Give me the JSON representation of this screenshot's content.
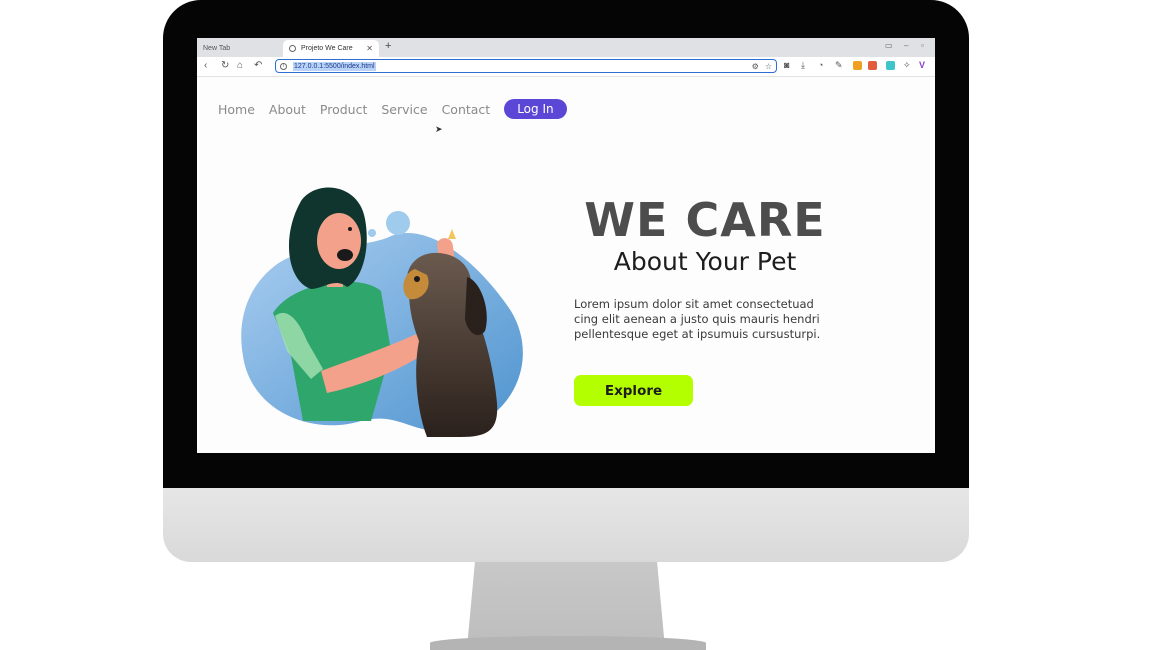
{
  "browser": {
    "tabs": [
      {
        "label": "New Tab",
        "active": false
      },
      {
        "label": "Projeto We Care",
        "active": true
      }
    ],
    "new_tab_symbol": "+",
    "url": "127.0.0.1:5500/index.html",
    "nav_icons": [
      "back-icon",
      "reload-icon",
      "home-icon",
      "undo-icon"
    ],
    "extension_colors": [
      "#e25b3a",
      "#f0a020",
      "#3fc4c9",
      "#8a3fd0"
    ]
  },
  "page": {
    "nav": {
      "items": [
        "Home",
        "About",
        "Product",
        "Service",
        "Contact"
      ],
      "login_label": "Log In"
    },
    "hero": {
      "title": "WE CARE",
      "subtitle": "About Your Pet",
      "text_lines": [
        "Lorem ipsum dolor sit amet consectetuad",
        "cing elit aenean a justo quis mauris hendri",
        "pellentesque eget at ipsumuis cursusturpi."
      ],
      "button_label": "Explore"
    }
  },
  "colors": {
    "login_button": "#5b47d6",
    "explore_button": "#b3ff00",
    "title": "#4d4d4d",
    "blob": "#7fb7e6",
    "shirt": "#2fa66b"
  }
}
